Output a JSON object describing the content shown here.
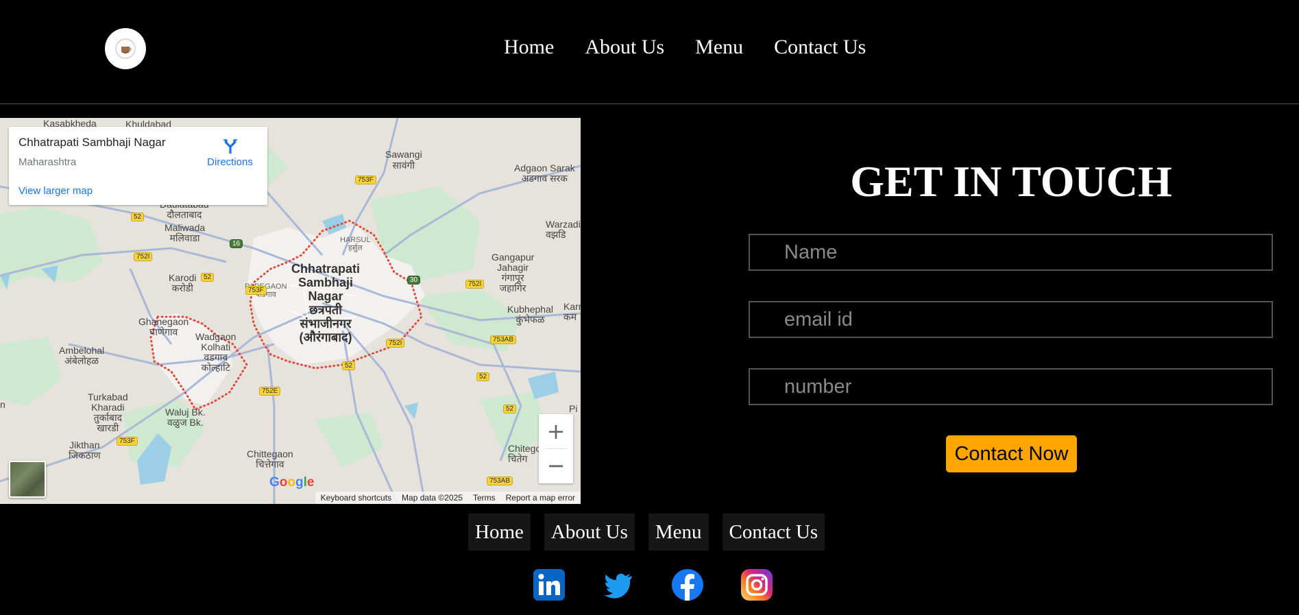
{
  "header": {
    "logo": "cafe-logo",
    "nav": [
      "Home",
      "About Us",
      "Menu",
      "Contact Us"
    ]
  },
  "map": {
    "place": "Chhatrapati Sambhaji Nagar",
    "region": "Maharashtra",
    "directions": "Directions",
    "view_larger": "View larger map",
    "zoom_in": "+",
    "zoom_out": "−",
    "attribution": [
      "Keyboard shortcuts",
      "Map data ©2025",
      "Terms",
      "Report a map error"
    ],
    "logo": "Google",
    "labels": {
      "city": [
        "Chhatrapati",
        "Sambhaji",
        "Nagar",
        "छत्रपती",
        "संभाजीनगर",
        "(औरंगाबाद)"
      ],
      "kasabkheda": "Kasabkheda",
      "khuldabad": "Khuldabad",
      "sawangi": [
        "Sawangi",
        "सावंगी"
      ],
      "adgaon": [
        "Adgaon Sarak",
        "अडगाव सरक"
      ],
      "daulatabad": [
        "Daulatabad",
        "दौलताबाद"
      ],
      "maliwada": [
        "Maliwada",
        "मलिवाडा"
      ],
      "warzadi": [
        "Warzadi",
        "वझडि"
      ],
      "harsul": [
        "HARSUL",
        "हर्सुल"
      ],
      "gangapur": [
        "Gangapur",
        "Jahagir",
        "गंगापूर",
        "जहागिर"
      ],
      "karodi": [
        "Karodi",
        "करोडी"
      ],
      "padegaon": [
        "PADEGAON",
        "पाडेगाव"
      ],
      "kubhephal": [
        "Kubhephal",
        "कुंभेफळ"
      ],
      "ghanegaon": [
        "Ghanegaon",
        "घाणेगाव"
      ],
      "wadgaon": [
        "Wadgaon",
        "Kolhati",
        "वडगाव",
        "कोल्हाटि"
      ],
      "ambelohal": [
        "Ambelohal",
        "अंबेलोहळ"
      ],
      "turkabad": [
        "Turkabad",
        "Kharadi",
        "तुर्काबाद",
        "खारडी"
      ],
      "waluj": [
        "Waluj Bk.",
        "वळुज Bk."
      ],
      "jikthan": [
        "Jikthan",
        "जिकठाण"
      ],
      "chittegaon": [
        "Chittegaon",
        "चित्तेगाव"
      ],
      "chitego": [
        "Chitego",
        "चितेग"
      ],
      "karm": [
        "Karr",
        "कम"
      ],
      "pi": "Pi",
      "n": "n"
    },
    "shields": [
      "52",
      "753F",
      "16",
      "752I",
      "52",
      "753F",
      "30",
      "752I",
      "753AB",
      "752I",
      "52",
      "752E",
      "52",
      "52",
      "753F",
      "753AB"
    ]
  },
  "contact": {
    "title": "GET IN TOUCH",
    "name_placeholder": "Name",
    "email_placeholder": "email id",
    "number_placeholder": "number",
    "button": "Contact Now",
    "button_color": "#ffa500"
  },
  "footer": {
    "nav": [
      "Home",
      "About Us",
      "Menu",
      "Contact Us"
    ],
    "social": [
      "linkedin-icon",
      "twitter-icon",
      "facebook-icon",
      "instagram-icon"
    ]
  }
}
